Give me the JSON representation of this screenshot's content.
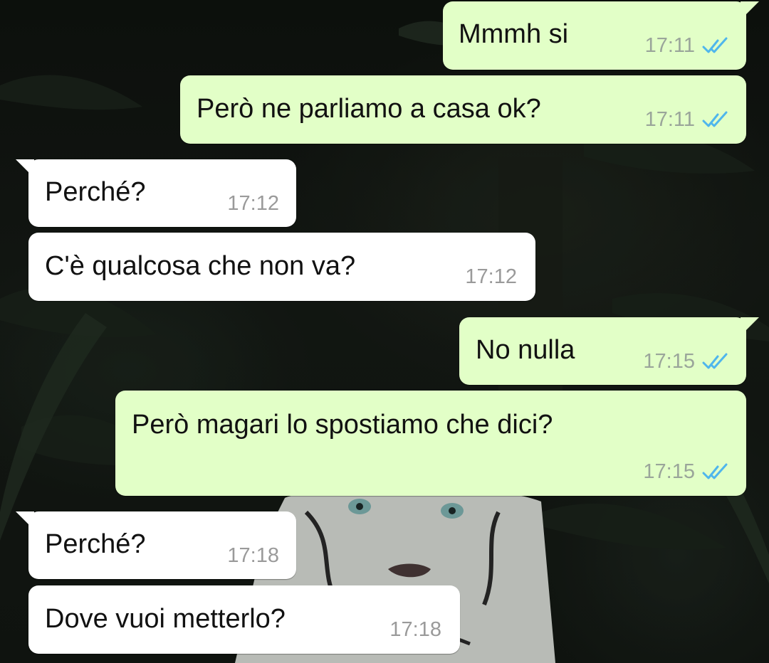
{
  "chat": {
    "messages": [
      {
        "text": "Mmmh si",
        "time": "17:11",
        "direction": "out",
        "status": "read"
      },
      {
        "text": "Però ne parliamo a casa ok?",
        "time": "17:11",
        "direction": "out",
        "status": "read"
      },
      {
        "text": "Perché?",
        "time": "17:12",
        "direction": "in"
      },
      {
        "text": "C'è qualcosa che non va?",
        "time": "17:12",
        "direction": "in"
      },
      {
        "text": "No nulla",
        "time": "17:15",
        "direction": "out",
        "status": "read"
      },
      {
        "text": "Però magari lo spostiamo che dici?",
        "time": "17:15",
        "direction": "out",
        "status": "read"
      },
      {
        "text": "Perché?",
        "time": "17:18",
        "direction": "in"
      },
      {
        "text": "Dove vuoi metterlo?",
        "time": "17:18",
        "direction": "in"
      }
    ]
  },
  "colors": {
    "outgoing_bubble": "#e2ffc7",
    "incoming_bubble": "#ffffff",
    "read_ticks": "#4fb6ec"
  },
  "icons": {
    "read_receipt": "double-check-icon",
    "wallpaper": "white-tiger-jungle-wallpaper"
  }
}
